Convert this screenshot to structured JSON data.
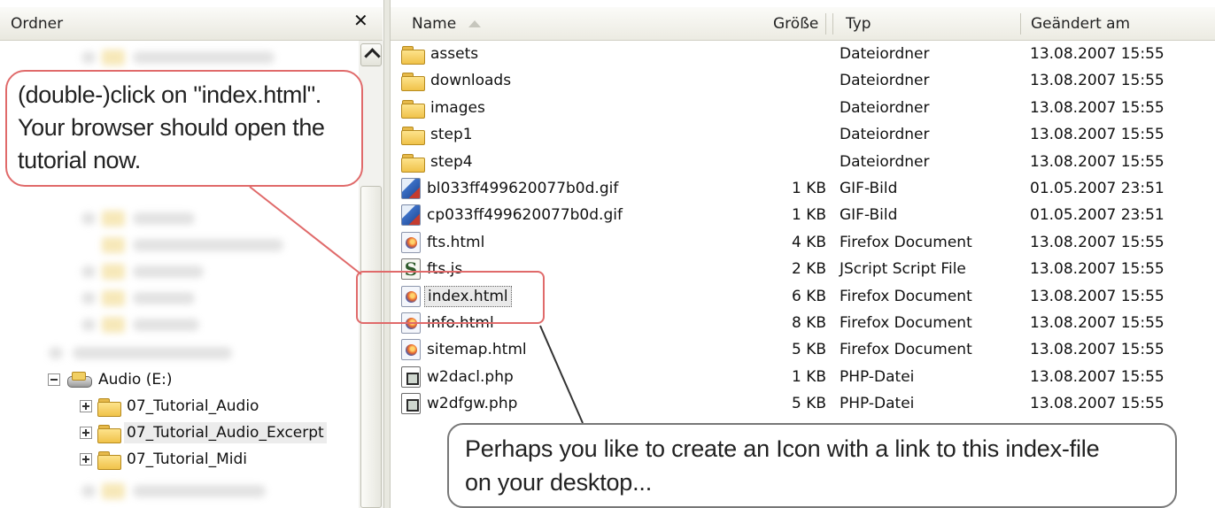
{
  "folder_pane": {
    "title": "Ordner",
    "close_glyph": "✕",
    "tree": [
      {
        "label": "Audio (E:)",
        "icon": "drive-icon",
        "expander": "minus"
      },
      {
        "label": "07_Tutorial_Audio",
        "icon": "folder-icon",
        "expander": "plus"
      },
      {
        "label": "07_Tutorial_Audio_Excerpt",
        "icon": "folder-icon",
        "expander": "plus",
        "selected": true
      },
      {
        "label": "07_Tutorial_Midi",
        "icon": "folder-icon",
        "expander": "plus"
      }
    ]
  },
  "file_list": {
    "columns": {
      "name": "Name",
      "size": "Größe",
      "type": "Typ",
      "modified": "Geändert am"
    },
    "sort_column": "name",
    "rows": [
      {
        "name": "assets",
        "size": "",
        "type": "Dateiordner",
        "modified": "13.08.2007 15:55",
        "icon": "folder-icon"
      },
      {
        "name": "downloads",
        "size": "",
        "type": "Dateiordner",
        "modified": "13.08.2007 15:55",
        "icon": "folder-icon"
      },
      {
        "name": "images",
        "size": "",
        "type": "Dateiordner",
        "modified": "13.08.2007 15:55",
        "icon": "folder-icon"
      },
      {
        "name": "step1",
        "size": "",
        "type": "Dateiordner",
        "modified": "13.08.2007 15:55",
        "icon": "folder-icon"
      },
      {
        "name": "step4",
        "size": "",
        "type": "Dateiordner",
        "modified": "13.08.2007 15:55",
        "icon": "folder-icon"
      },
      {
        "name": "bl033ff499620077b0d.gif",
        "size": "1 KB",
        "type": "GIF-Bild",
        "modified": "01.05.2007 23:51",
        "icon": "gif-image-icon"
      },
      {
        "name": "cp033ff499620077b0d.gif",
        "size": "1 KB",
        "type": "GIF-Bild",
        "modified": "01.05.2007 23:51",
        "icon": "gif-image-icon"
      },
      {
        "name": "fts.html",
        "size": "4 KB",
        "type": "Firefox Document",
        "modified": "13.08.2007 15:55",
        "icon": "firefox-document-icon"
      },
      {
        "name": "fts.js",
        "size": "2 KB",
        "type": "JScript Script File",
        "modified": "13.08.2007 15:55",
        "icon": "jscript-file-icon"
      },
      {
        "name": "index.html",
        "size": "6 KB",
        "type": "Firefox Document",
        "modified": "13.08.2007 15:55",
        "icon": "firefox-document-icon",
        "focused": true
      },
      {
        "name": "info.html",
        "size": "8 KB",
        "type": "Firefox Document",
        "modified": "13.08.2007 15:55",
        "icon": "firefox-document-icon"
      },
      {
        "name": "sitemap.html",
        "size": "5 KB",
        "type": "Firefox Document",
        "modified": "13.08.2007 15:55",
        "icon": "firefox-document-icon"
      },
      {
        "name": "w2dacl.php",
        "size": "1 KB",
        "type": "PHP-Datei",
        "modified": "13.08.2007 15:55",
        "icon": "php-file-icon"
      },
      {
        "name": "w2dfgw.php",
        "size": "5 KB",
        "type": "PHP-Datei",
        "modified": "13.08.2007 15:55",
        "icon": "php-file-icon"
      }
    ]
  },
  "annotations": {
    "callout_top": [
      "(double-)click on \"index.html\".",
      "Your browser should open the",
      "tutorial now."
    ],
    "callout_bottom": [
      "Perhaps you like to create an Icon with a link to this index-file",
      "on your desktop..."
    ],
    "accent_color": "#e06a6a"
  }
}
